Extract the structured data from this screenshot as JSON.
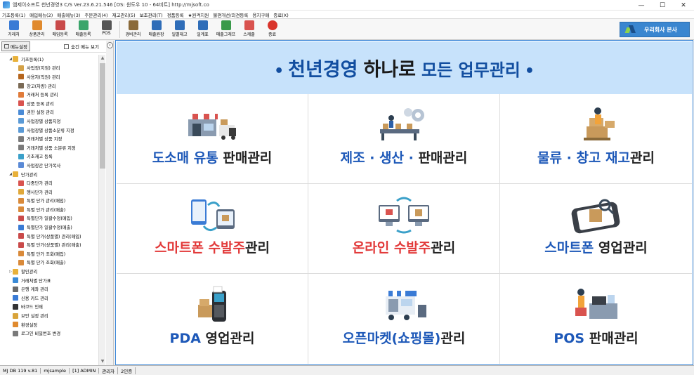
{
  "window": {
    "title": "엠제이소프트 천년경영3 C/S  Ver.23.6.21.546  [OS: 윈도우 10 - 64비트]  http://mjsoft.co",
    "minimize": "—",
    "maximize": "☐",
    "close": "✕"
  },
  "menu": [
    "기초등록(1)",
    "매입메뉴(2)",
    "매출메뉴(3)",
    "주문관리(4)",
    "재고관리(5)",
    "보조관리(T)",
    "정품등록",
    "★원격지원",
    "불편개선/의견등록",
    "용지구매",
    "종료(X)"
  ],
  "toolbar": [
    {
      "label": "거래처",
      "icon": "customer-icon",
      "color": "#3a7bd5"
    },
    {
      "label": "상품관리",
      "icon": "product-icon",
      "color": "#e08a2e"
    },
    {
      "label": "매입등록",
      "icon": "purchase-icon",
      "color": "#c94a4a"
    },
    {
      "label": "매출등록",
      "icon": "sales-icon",
      "color": "#3aa56b"
    },
    {
      "label": "POS",
      "icon": "pos-icon",
      "color": "#555555"
    },
    {
      "label": "경비관리",
      "icon": "expense-icon",
      "color": "#8a6a3a"
    },
    {
      "label": "매출원장",
      "icon": "ledger-icon",
      "color": "#2f6db8"
    },
    {
      "label": "일별재고",
      "icon": "stock-icon",
      "color": "#2f6db8"
    },
    {
      "label": "일계표",
      "icon": "daily-icon",
      "color": "#2f6db8"
    },
    {
      "label": "매출그래프",
      "icon": "graph-icon",
      "color": "#3a9a4a"
    },
    {
      "label": "스케줄",
      "icon": "calendar-icon",
      "color": "#d9534f"
    },
    {
      "label": "종료",
      "icon": "power-icon",
      "color": "#d9342b"
    }
  ],
  "hq_button": "우리회사 본사",
  "sidebar": {
    "menu_settings": "메뉴설정",
    "hide_menu": "숨긴 메뉴 보기",
    "items": [
      {
        "label": "기초등록(1)",
        "level": 0,
        "toggle": "◢",
        "color": "#e8b13a"
      },
      {
        "label": "사업장(지점) 관리",
        "level": 1,
        "toggle": "",
        "color": "#d4a248"
      },
      {
        "label": "사용자(직원) 관리",
        "level": 1,
        "toggle": "",
        "color": "#b5651d"
      },
      {
        "label": "창고(차량) 관리",
        "level": 1,
        "toggle": "",
        "color": "#7a6a55"
      },
      {
        "label": "거래처 등록 관리",
        "level": 1,
        "toggle": "",
        "color": "#e07b3a"
      },
      {
        "label": "상품 등록 관리",
        "level": 1,
        "toggle": "",
        "color": "#d9534f"
      },
      {
        "label": "권한 설정 관리",
        "level": 1,
        "toggle": "",
        "color": "#4a8bd6"
      },
      {
        "label": "사업장별 상품지정",
        "level": 1,
        "toggle": "",
        "color": "#5a9ad6"
      },
      {
        "label": "사업장별 상품소분류 지정",
        "level": 1,
        "toggle": "",
        "color": "#5a9ad6"
      },
      {
        "label": "거래처별 상품 지정",
        "level": 1,
        "toggle": "",
        "color": "#7a7a7a"
      },
      {
        "label": "거래처별 상품 소분류 지정",
        "level": 1,
        "toggle": "",
        "color": "#7a7a7a"
      },
      {
        "label": "기초재고 등록",
        "level": 1,
        "toggle": "",
        "color": "#3aa0c9"
      },
      {
        "label": "사업장간 단가복사",
        "level": 1,
        "toggle": "",
        "color": "#5a8ad6"
      },
      {
        "label": "단가관리",
        "level": 0,
        "toggle": "◢",
        "color": "#e8b13a"
      },
      {
        "label": "다중단가 관리",
        "level": 1,
        "toggle": "",
        "color": "#d9534f"
      },
      {
        "label": "행사단가 관리",
        "level": 1,
        "toggle": "",
        "color": "#e0a83a"
      },
      {
        "label": "특별 단가 관리(매입)",
        "level": 1,
        "toggle": "",
        "color": "#d98a3a"
      },
      {
        "label": "특별 단가 관리(매출)",
        "level": 1,
        "toggle": "",
        "color": "#d98a3a"
      },
      {
        "label": "특별단가 일괄수정(매입)",
        "level": 1,
        "toggle": "",
        "color": "#c94a4a"
      },
      {
        "label": "특별단가 일괄수정(매출)",
        "level": 1,
        "toggle": "",
        "color": "#3a7bd5"
      },
      {
        "label": "특별 단가(상품별) 관리(매입)",
        "level": 1,
        "toggle": "",
        "color": "#c94a4a"
      },
      {
        "label": "특별 단가(상품별) 관리(매출)",
        "level": 1,
        "toggle": "",
        "color": "#c94a4a"
      },
      {
        "label": "특별 단가 조회(매입)",
        "level": 1,
        "toggle": "",
        "color": "#d98a3a"
      },
      {
        "label": "특별 단가 조회(매출)",
        "level": 1,
        "toggle": "",
        "color": "#d98a3a"
      },
      {
        "label": "할인관리",
        "level": 0,
        "toggle": "▷",
        "color": "#e8b13a"
      },
      {
        "label": "거래처별 단가표",
        "level": 0,
        "toggle": "",
        "color": "#3a8ad6"
      },
      {
        "label": "은행 계좌 관리",
        "level": 0,
        "toggle": "",
        "color": "#6a6a6a"
      },
      {
        "label": "신용 카드 관리",
        "level": 0,
        "toggle": "",
        "color": "#3a7bd5"
      },
      {
        "label": "바코드 인쇄",
        "level": 0,
        "toggle": "",
        "color": "#333333"
      },
      {
        "label": "보안 설정 관리",
        "level": 0,
        "toggle": "",
        "color": "#d9a43a"
      },
      {
        "label": "환경설정",
        "level": 0,
        "toggle": "",
        "color": "#e08a2e"
      },
      {
        "label": "로그인 비밀번호 변경",
        "level": 0,
        "toggle": "",
        "color": "#7a7a7a"
      }
    ]
  },
  "banner": {
    "part1": "천년경영",
    "part2": "하나로",
    "part3": "모든 업무관리",
    "bullet": "•"
  },
  "cells": [
    {
      "key": "wholesale",
      "parts": [
        {
          "t": "도소매 유통 ",
          "c": "blue"
        },
        {
          "t": "판매관리",
          "c": "dark"
        }
      ]
    },
    {
      "key": "manufacturing",
      "parts": [
        {
          "t": "제조 · 생산 · ",
          "c": "blue"
        },
        {
          "t": "판매관리",
          "c": "dark"
        }
      ]
    },
    {
      "key": "logistics",
      "parts": [
        {
          "t": "물류 · 창고 재고",
          "c": "blue"
        },
        {
          "t": "관리",
          "c": "dark"
        }
      ]
    },
    {
      "key": "smartphone-order",
      "parts": [
        {
          "t": "스마트폰 수발주",
          "c": "red"
        },
        {
          "t": "관리",
          "c": "dark"
        }
      ]
    },
    {
      "key": "online-order",
      "parts": [
        {
          "t": "온라인 수발주",
          "c": "red"
        },
        {
          "t": "관리",
          "c": "dark"
        }
      ]
    },
    {
      "key": "smartphone-sales",
      "parts": [
        {
          "t": "스마트폰 ",
          "c": "blue"
        },
        {
          "t": "영업관리",
          "c": "dark"
        }
      ]
    },
    {
      "key": "pda",
      "parts": [
        {
          "t": "PDA ",
          "c": "blue"
        },
        {
          "t": "영업관리",
          "c": "dark"
        }
      ]
    },
    {
      "key": "openmarket",
      "parts": [
        {
          "t": "오픈마켓(쇼핑몰)",
          "c": "blue"
        },
        {
          "t": "관리",
          "c": "dark"
        }
      ]
    },
    {
      "key": "pos",
      "parts": [
        {
          "t": "POS ",
          "c": "blue"
        },
        {
          "t": "판매관리",
          "c": "dark"
        }
      ]
    }
  ],
  "status": [
    "MJ DB 119 v.81",
    "mjsample",
    "[1] ADMIN",
    "관리자",
    "2인증"
  ],
  "colors": {
    "accent": "#3a86d0",
    "banner_bg": "#c7e2fb",
    "banner_text": "#124ea0",
    "red": "#e23a3a"
  }
}
